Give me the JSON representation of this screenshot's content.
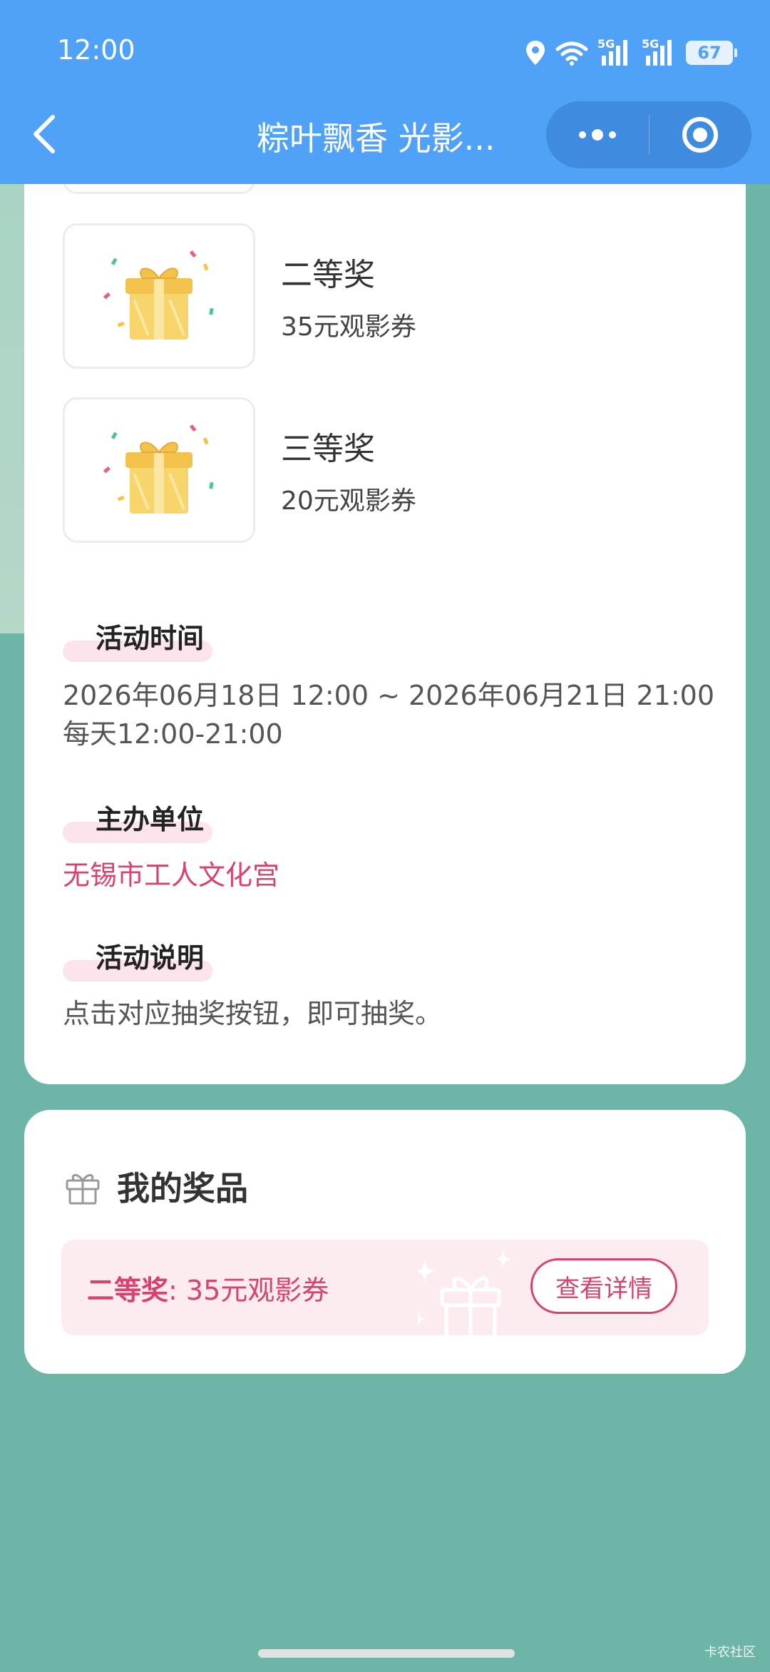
{
  "status_bar": {
    "time": "12:00",
    "battery": "67",
    "network_1": "5G",
    "network_2": "5G"
  },
  "nav": {
    "title": "粽叶飘香 光影..."
  },
  "prizes": [
    {
      "level": "二等奖",
      "desc": "35元观影券"
    },
    {
      "level": "三等奖",
      "desc": "20元观影券"
    }
  ],
  "sections": {
    "time": {
      "title": "活动时间",
      "line1": "2026年06月18日 12:00 ~ 2026年06月21日 21:00",
      "line2": "每天12:00-21:00"
    },
    "organizer": {
      "title": "主办单位",
      "value": "无锡市工人文化宫"
    },
    "description": {
      "title": "活动说明",
      "value": "点击对应抽奖按钮，即可抽奖。"
    }
  },
  "my_prizes": {
    "title": "我的奖品",
    "prize_level": "二等奖",
    "prize_sep": ": ",
    "prize_desc": "35元观影券",
    "detail_label": "查看详情"
  },
  "watermark": "卡农社区",
  "colors": {
    "header": "#4fa2f7",
    "accent": "#d9426e",
    "background": "#6db5a6"
  }
}
